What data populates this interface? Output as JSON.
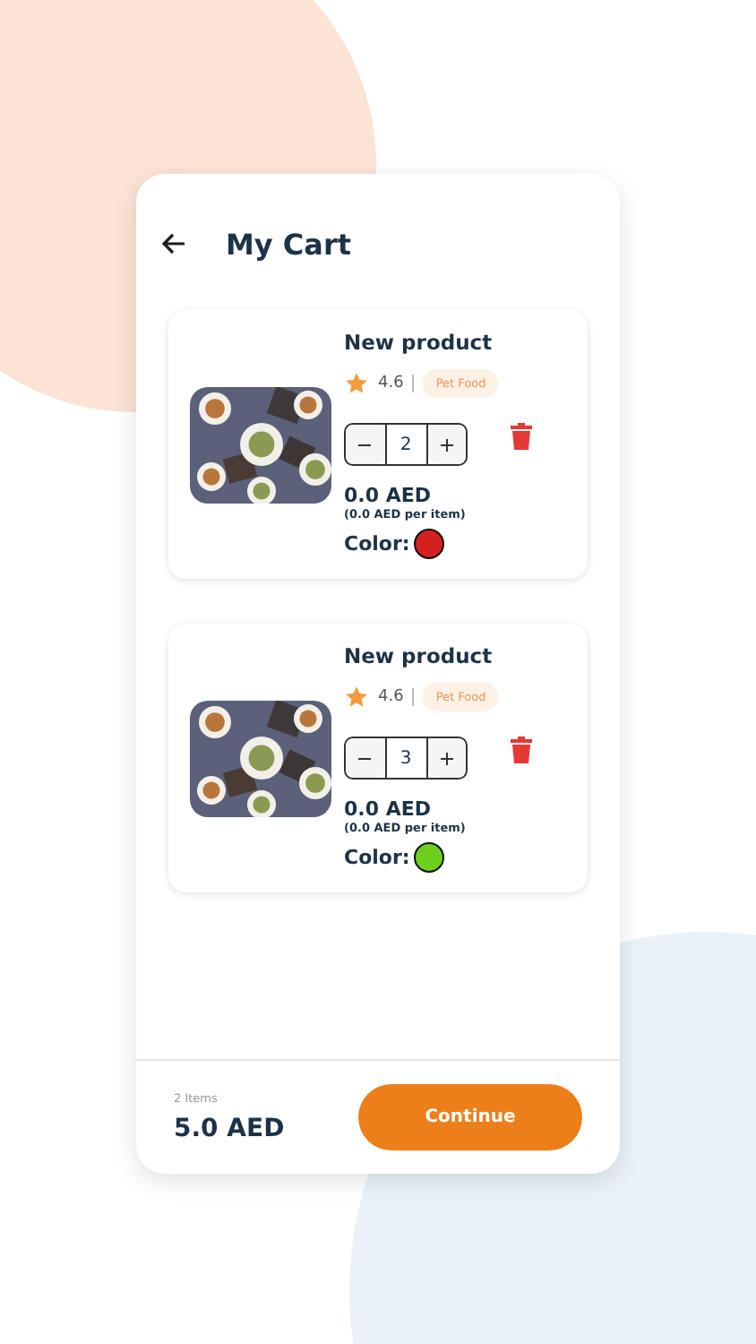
{
  "header": {
    "title": "My Cart"
  },
  "items": [
    {
      "name": "New product",
      "rating": "4.6",
      "category": "Pet Food",
      "quantity": "2",
      "price": "0.0 AED",
      "unit_price": "(0.0 AED per item)",
      "color_label": "Color:",
      "color": "#d42020"
    },
    {
      "name": "New product",
      "rating": "4.6",
      "category": "Pet Food",
      "quantity": "3",
      "price": "0.0 AED",
      "unit_price": "(0.0 AED per item)",
      "color_label": "Color:",
      "color": "#6ccf1e"
    }
  ],
  "footer": {
    "count": "2 Items",
    "total": "5.0 AED",
    "button": "Continue"
  }
}
